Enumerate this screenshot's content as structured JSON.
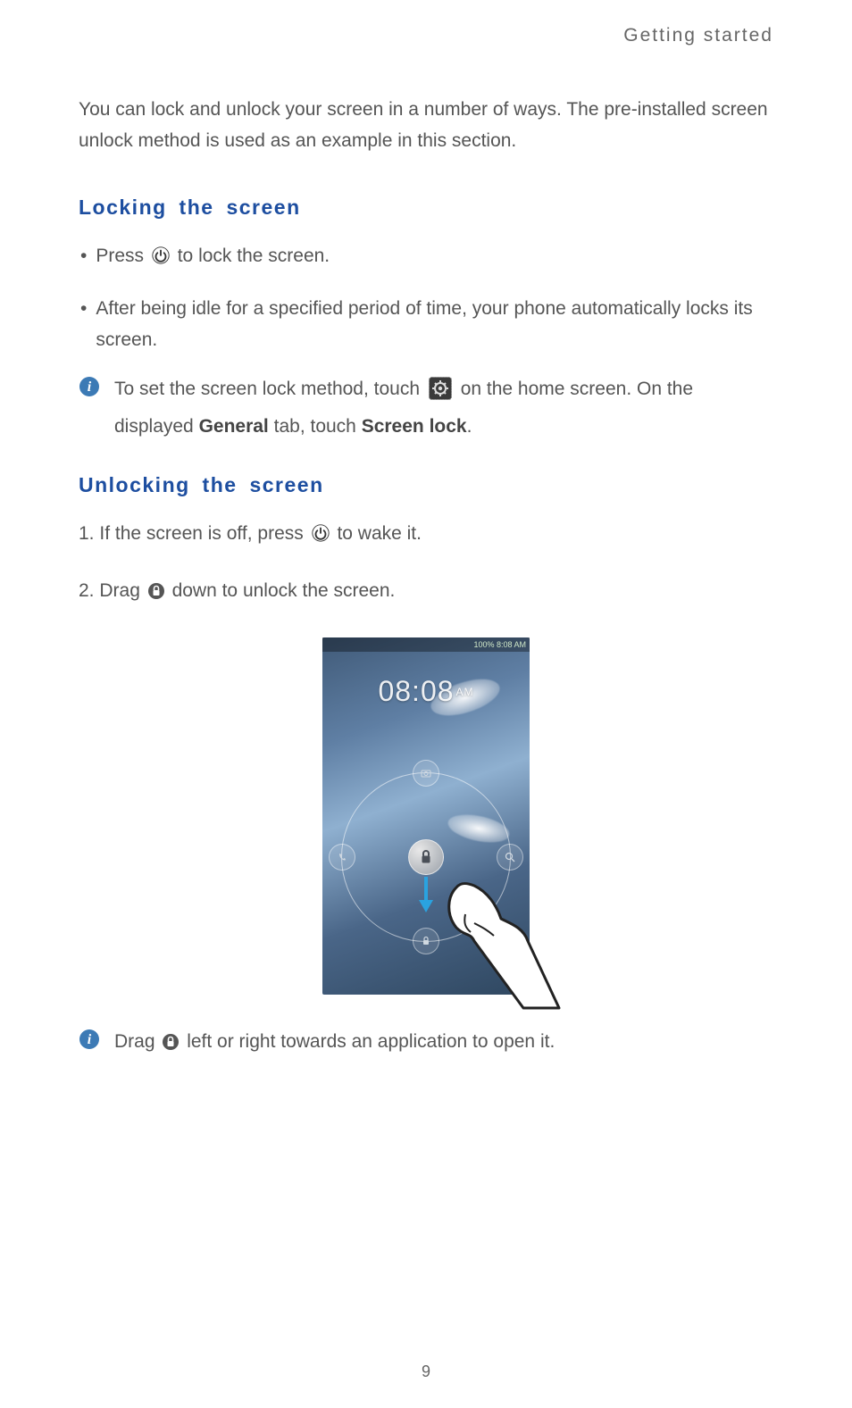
{
  "header": {
    "title": "Getting started"
  },
  "intro": "You can lock and unlock your screen in a number of ways. The pre-installed screen unlock method is used as an example in this section.",
  "section_lock": {
    "title": "Locking  the  screen",
    "b1_pre": "Press ",
    "b1_post": " to lock the screen.",
    "b2": "After being idle for a specified period of time, your phone automatically locks its screen.",
    "note_pre": "To set the screen lock method, touch ",
    "note_mid": " on the home screen. On the displayed ",
    "note_bold1": "General",
    "note_mid2": " tab, touch ",
    "note_bold2": "Screen lock",
    "note_end": "."
  },
  "section_unlock": {
    "title": "Unlocking  the  screen",
    "s1_num": "1.",
    "s1_pre": "If the screen is off, press ",
    "s1_post": " to wake it.",
    "s2_num": "2.",
    "s2_pre": "Drag ",
    "s2_post": " down to unlock the screen."
  },
  "lockscreen": {
    "status": "100%  8:08 AM",
    "clock": "08:08",
    "ampm": "AM"
  },
  "footer_note": {
    "pre": "Drag ",
    "post": " left or right towards an application to open it."
  },
  "page_number": "9"
}
